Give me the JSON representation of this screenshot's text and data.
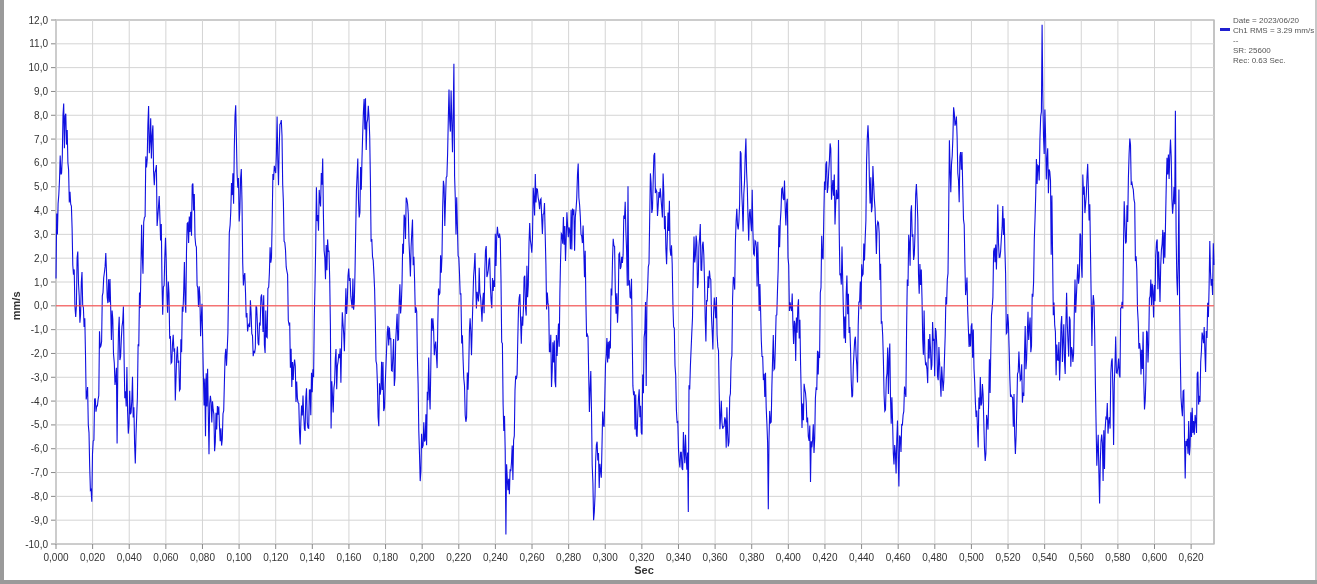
{
  "chart": {
    "ylabel": "mm/s",
    "xlabel": "Sec",
    "yticks": [
      "12,0",
      "11,0",
      "10,0",
      "9,0",
      "8,0",
      "7,0",
      "6,0",
      "5,0",
      "4,0",
      "3,0",
      "2,0",
      "1,0",
      "0,0",
      "-1,0",
      "-2,0",
      "-3,0",
      "-4,0",
      "-5,0",
      "-6,0",
      "-7,0",
      "-8,0",
      "-9,0",
      "-10,0"
    ],
    "xticks": [
      "0,000",
      "0,020",
      "0,040",
      "0,060",
      "0,080",
      "0,100",
      "0,120",
      "0,140",
      "0,160",
      "0,180",
      "0,200",
      "0,220",
      "0,240",
      "0,260",
      "0,280",
      "0,300",
      "0,320",
      "0,340",
      "0,360",
      "0,380",
      "0,400",
      "0,420",
      "0,440",
      "0,460",
      "0,480",
      "0,500",
      "0,520",
      "0,540",
      "0,560",
      "0,580",
      "0,600",
      "0,620"
    ]
  },
  "legend": {
    "color": "#2020d0",
    "lines": [
      "Date = 2023/06/20",
      "Ch1 RMS = 3.29 mm/s",
      "--",
      "SR: 25600",
      "Rec: 0.63 Sec."
    ]
  }
}
